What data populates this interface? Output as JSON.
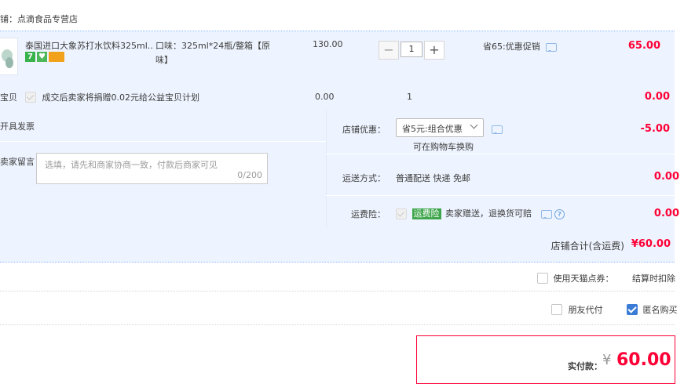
{
  "store": {
    "name": "铺：点滴食品专营店"
  },
  "item": {
    "title": "泰国进口大象苏打水饮料325ml...",
    "spec": "口味：325ml*24瓶/整箱【原味】",
    "unit_price": "130.00",
    "quantity": "1",
    "qty_minus": "−",
    "qty_plus": "+",
    "promo": "省65:优惠促销",
    "total": "65.00",
    "badges": [
      {
        "icon": "seven-day-return-icon",
        "text": "7"
      },
      {
        "icon": "shield-guarantee-icon",
        "text": "♥"
      },
      {
        "icon": "credit-card-icon",
        "text": ""
      }
    ]
  },
  "charity": {
    "label": "宝贝",
    "text": "成交后卖家将捐赠0.02元给公益宝贝计划",
    "price": "0.00",
    "qty": "1",
    "total": "0.00"
  },
  "invoice": {
    "label": "开具发票"
  },
  "memo": {
    "label": "卖家留言：",
    "placeholder": "选填，请先和商家协商一致，付款后商家可见",
    "count": "0/200"
  },
  "shop_discount": {
    "label": "店铺优惠：",
    "selected": "省5元:组合优惠",
    "note": "可在购物车换购",
    "amount": "-5.00"
  },
  "shipping": {
    "label": "运送方式：",
    "value": "普通配送 快递 免邮",
    "amount": "0.00"
  },
  "insurance": {
    "label": "运费险：",
    "tag": "运费险",
    "text": "卖家赠送，退换货可赔",
    "amount": "0.00"
  },
  "shop_total": {
    "label": "店铺合计(含运费)",
    "amount": "¥60.00"
  },
  "tmall_points": {
    "label": "使用天猫点券：",
    "value": "结算时扣除"
  },
  "friend_pay": {
    "label": "朋友代付"
  },
  "anonymous": {
    "label": "匿名购买"
  },
  "checkout": {
    "label": "实付款：",
    "currency": "¥",
    "amount": "60.00"
  },
  "colors": {
    "accent_red": "#ff0036",
    "row_bg": "#eef4ff",
    "dotted_line": "#80b2ff",
    "checkbox_blue": "#3a7bd5",
    "tag_green": "#3da54a"
  }
}
